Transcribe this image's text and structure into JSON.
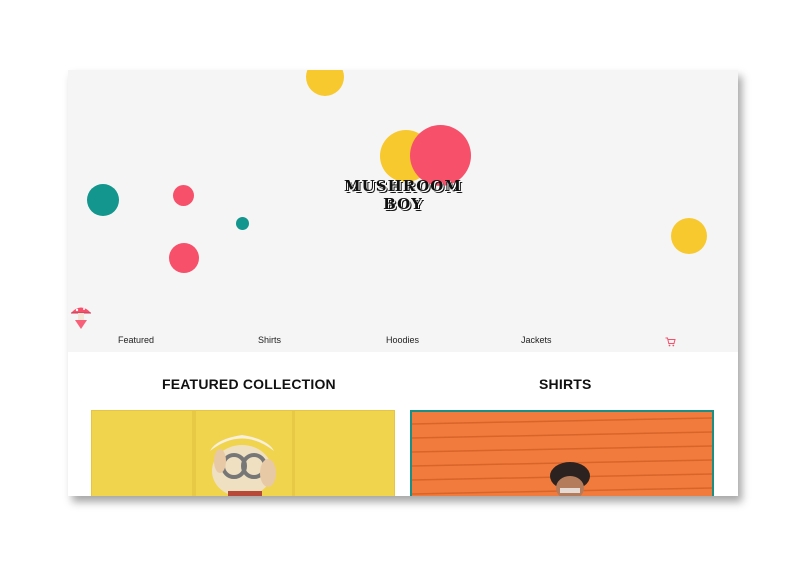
{
  "brand": {
    "name": "MUSHROOM BOY"
  },
  "nav": {
    "items": [
      {
        "label": "Featured"
      },
      {
        "label": "Shirts"
      },
      {
        "label": "Hoodies"
      },
      {
        "label": "Jackets"
      }
    ],
    "cart_icon": "cart-icon"
  },
  "sections": [
    {
      "title": "FEATURED COLLECTION"
    },
    {
      "title": "SHIRTS"
    }
  ],
  "colors": {
    "yellow": "#f7c92f",
    "pink": "#f7506a",
    "teal": "#13968d",
    "hero_bg": "#f5f5f5"
  }
}
